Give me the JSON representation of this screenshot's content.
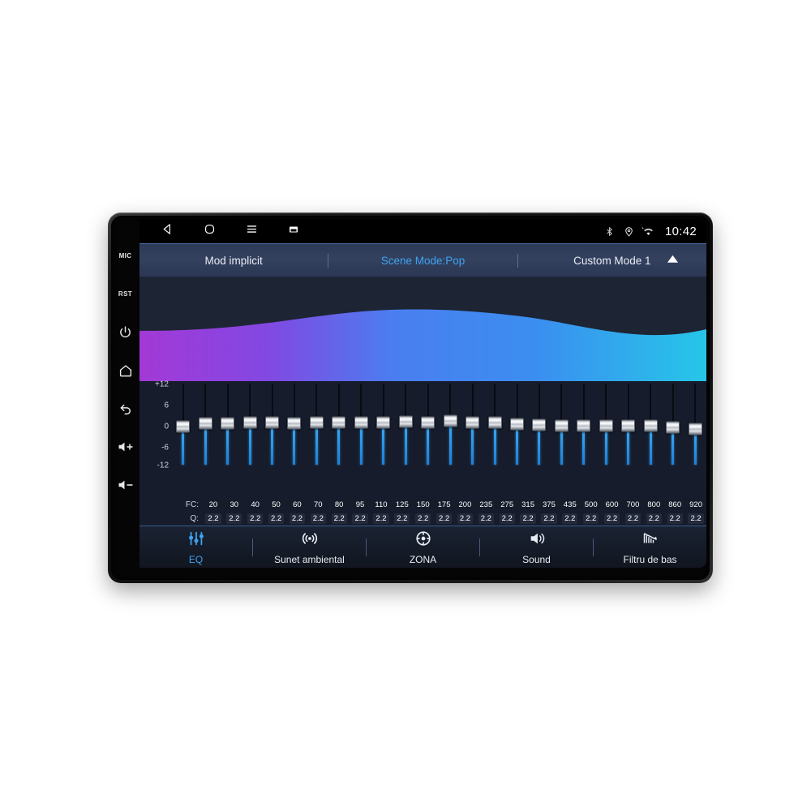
{
  "device": {
    "bezel_buttons": [
      {
        "name": "mic",
        "label": "MIC",
        "type": "text"
      },
      {
        "name": "reset",
        "label": "RST",
        "type": "text"
      },
      {
        "name": "power",
        "label": "power-icon",
        "type": "icon"
      },
      {
        "name": "home",
        "label": "home-icon",
        "type": "icon"
      },
      {
        "name": "back",
        "label": "back-icon",
        "type": "icon"
      },
      {
        "name": "volume-up",
        "label": "volume-up-icon",
        "type": "icon"
      },
      {
        "name": "volume-down",
        "label": "volume-down-icon",
        "type": "icon"
      }
    ]
  },
  "statusbar": {
    "nav": [
      {
        "name": "back-icon",
        "glyph": "triangle-left"
      },
      {
        "name": "home-icon",
        "glyph": "rounded-square"
      },
      {
        "name": "menu-icon",
        "glyph": "hamburger"
      },
      {
        "name": "screenshot-icon",
        "glyph": "screenshot"
      }
    ],
    "icons": [
      {
        "name": "bluetooth-icon"
      },
      {
        "name": "location-icon"
      },
      {
        "name": "wifi-icon"
      }
    ],
    "clock": "10:42"
  },
  "modebar": {
    "default_mode": "Mod implicit",
    "scene_mode": "Scene Mode:Pop",
    "custom_mode": "Custom Mode 1",
    "expand_icon": "chevron-up-icon",
    "active_color": "#3fa3ef"
  },
  "curve": {
    "gradient_stops": [
      "#a339d6",
      "#7b4ce0",
      "#4a7ef0",
      "#3b8ef0",
      "#26c6e8"
    ],
    "background": "#1d2433"
  },
  "equalizer": {
    "y_axis": [
      "+12",
      "6",
      "0",
      "-6",
      "-12"
    ],
    "fc_label": "FC:",
    "q_label": "Q:",
    "bands": [
      {
        "fc": "20",
        "q": "2.2",
        "gain": 0.0
      },
      {
        "fc": "30",
        "q": "2.2",
        "gain": 0.9
      },
      {
        "fc": "40",
        "q": "2.2",
        "gain": 1.0
      },
      {
        "fc": "50",
        "q": "2.2",
        "gain": 1.2
      },
      {
        "fc": "60",
        "q": "2.2",
        "gain": 1.1
      },
      {
        "fc": "70",
        "q": "2.2",
        "gain": 1.0
      },
      {
        "fc": "80",
        "q": "2.2",
        "gain": 1.3
      },
      {
        "fc": "95",
        "q": "2.2",
        "gain": 1.1
      },
      {
        "fc": "110",
        "q": "2.2",
        "gain": 1.3
      },
      {
        "fc": "125",
        "q": "2.2",
        "gain": 1.1
      },
      {
        "fc": "150",
        "q": "2.2",
        "gain": 1.4
      },
      {
        "fc": "175",
        "q": "2.2",
        "gain": 1.2
      },
      {
        "fc": "200",
        "q": "2.2",
        "gain": 1.6
      },
      {
        "fc": "235",
        "q": "2.2",
        "gain": 1.3
      },
      {
        "fc": "275",
        "q": "2.2",
        "gain": 1.1
      },
      {
        "fc": "315",
        "q": "2.2",
        "gain": 0.7
      },
      {
        "fc": "375",
        "q": "2.2",
        "gain": 0.4
      },
      {
        "fc": "435",
        "q": "2.2",
        "gain": 0.2
      },
      {
        "fc": "500",
        "q": "2.2",
        "gain": 0.3
      },
      {
        "fc": "600",
        "q": "2.2",
        "gain": 0.3
      },
      {
        "fc": "700",
        "q": "2.2",
        "gain": 0.3
      },
      {
        "fc": "800",
        "q": "2.2",
        "gain": 0.2
      },
      {
        "fc": "860",
        "q": "2.2",
        "gain": -0.3
      },
      {
        "fc": "920",
        "q": "2.2",
        "gain": -0.8
      }
    ]
  },
  "bottomnav": {
    "items": [
      {
        "label": "EQ",
        "icon": "equalizer-icon",
        "active": true
      },
      {
        "label": "Sunet ambiental",
        "icon": "surround-sound-icon",
        "active": false
      },
      {
        "label": "ZONA",
        "icon": "zone-target-icon",
        "active": false
      },
      {
        "label": "Sound",
        "icon": "speaker-icon",
        "active": false
      },
      {
        "label": "Filtru de bas",
        "icon": "bass-filter-icon",
        "active": false
      }
    ]
  }
}
